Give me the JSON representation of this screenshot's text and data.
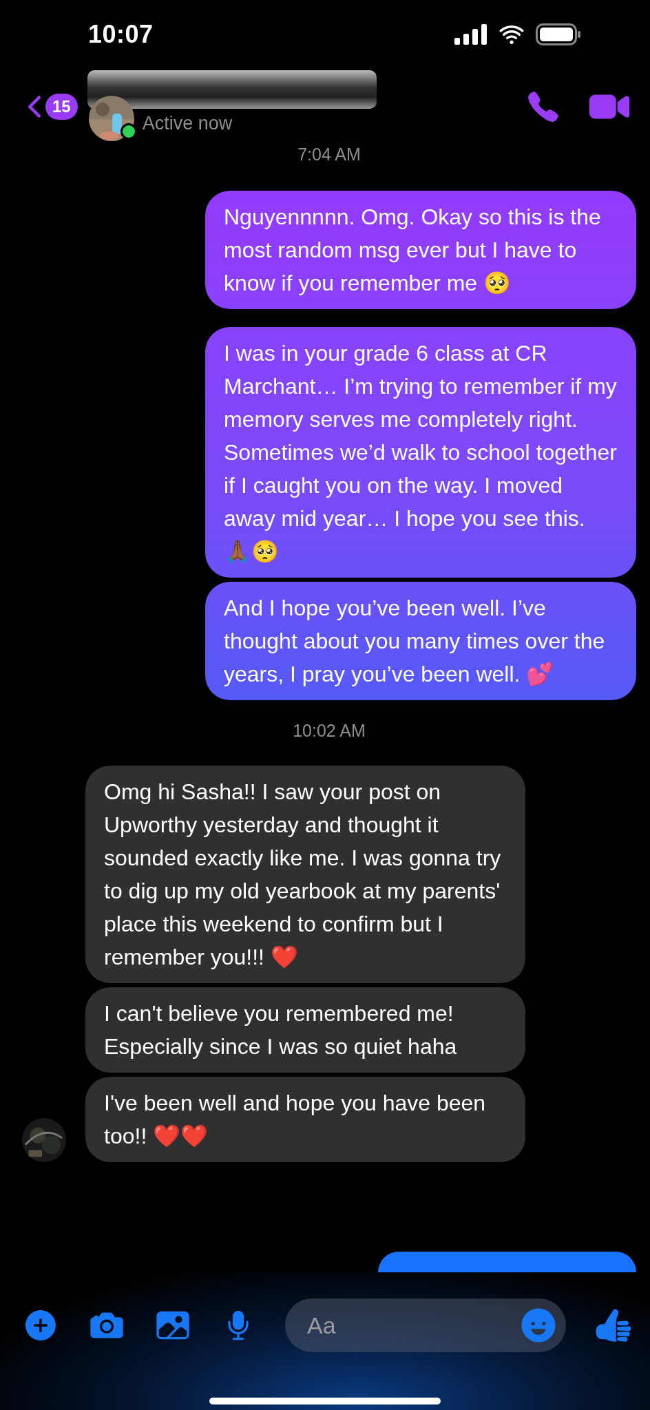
{
  "status_bar": {
    "time": "10:07"
  },
  "header": {
    "back_badge": "15",
    "online": true,
    "status": "Active now"
  },
  "messages": [
    {
      "kind": "timestamp",
      "text": "7:04 AM"
    },
    {
      "kind": "outgoing",
      "text": "Nguyennnnn. Omg. Okay so this is the most random msg ever but I have to know if you remember me 🥺"
    },
    {
      "kind": "outgoing",
      "text": "I was in your grade 6 class at CR Marchant… I’m trying to remember if my memory serves me completely right. Sometimes we’d walk to school together if I caught you on the way. I moved away mid year… I hope you see this. 🙏🏾🥺"
    },
    {
      "kind": "outgoing",
      "text": "And I hope you’ve been well. I’ve thought about you many times over the years, I pray you’ve been well. 💕"
    },
    {
      "kind": "timestamp",
      "text": "10:02 AM"
    },
    {
      "kind": "incoming",
      "show_avatar": false,
      "text": "Omg hi Sasha!! I saw your post on Upworthy yesterday and thought it sounded exactly like me. I was gonna try to dig up my old yearbook at my parents' place this weekend to confirm but I remember you!!! ❤️"
    },
    {
      "kind": "incoming",
      "show_avatar": false,
      "text": "I can't believe you remembered me! Especially since I was so quiet haha"
    },
    {
      "kind": "incoming",
      "show_avatar": true,
      "text": "I've been well and hope you have been too!! ❤️❤️"
    },
    {
      "kind": "outgoing_partial"
    }
  ],
  "composer": {
    "placeholder": "Aa"
  }
}
